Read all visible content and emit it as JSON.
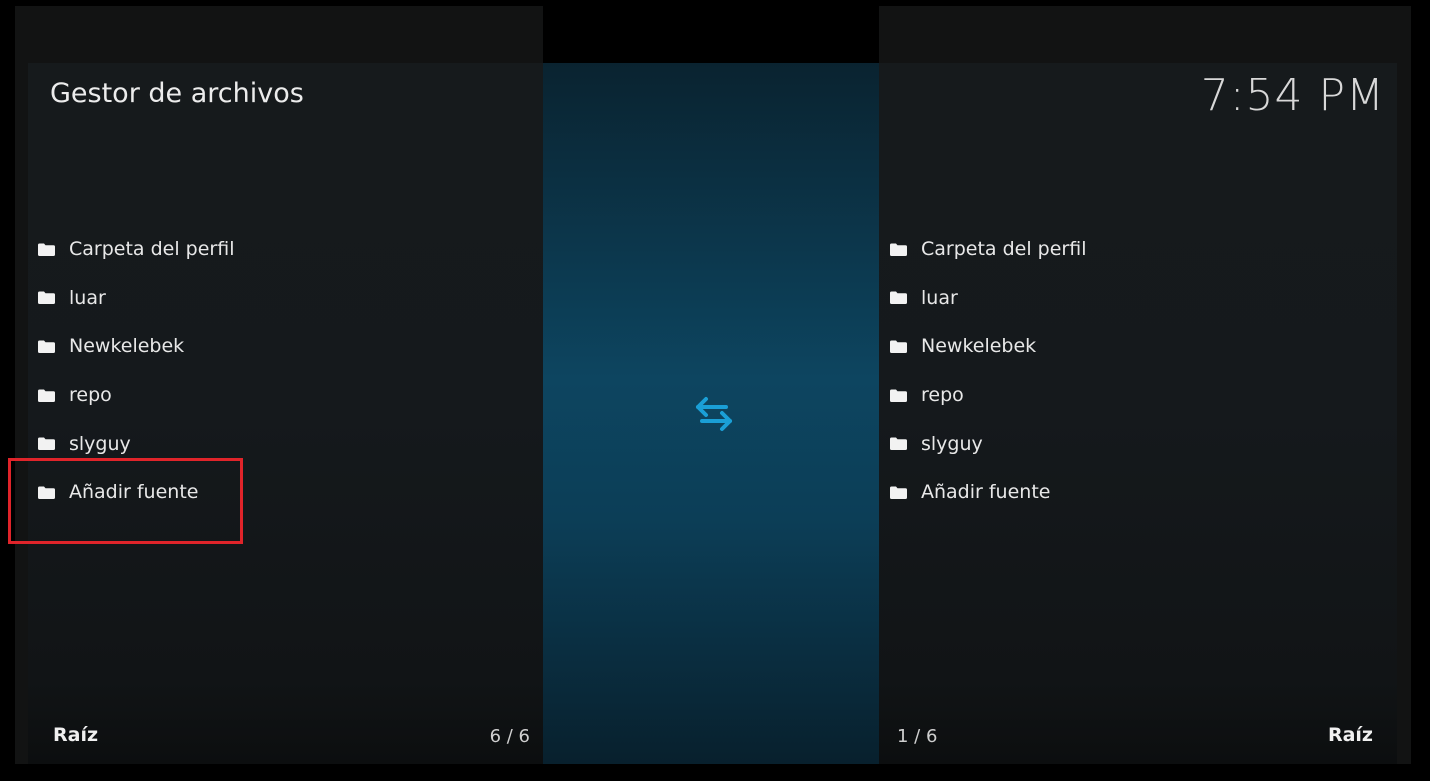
{
  "header": {
    "title": "Gestor de archivos",
    "clock": "7:54 PM"
  },
  "left_pane": {
    "items": [
      {
        "label": "Carpeta del perfil",
        "icon": "folder-icon"
      },
      {
        "label": "luar",
        "icon": "folder-icon"
      },
      {
        "label": "Newkelebek",
        "icon": "folder-icon"
      },
      {
        "label": "repo",
        "icon": "folder-icon"
      },
      {
        "label": "slyguy",
        "icon": "folder-icon"
      },
      {
        "label": "Añadir fuente",
        "icon": "folder-icon"
      }
    ],
    "location": "Raíz",
    "counter": "6 / 6"
  },
  "right_pane": {
    "items": [
      {
        "label": "Carpeta del perfil",
        "icon": "folder-icon"
      },
      {
        "label": "luar",
        "icon": "folder-icon"
      },
      {
        "label": "Newkelebek",
        "icon": "folder-icon"
      },
      {
        "label": "repo",
        "icon": "folder-icon"
      },
      {
        "label": "slyguy",
        "icon": "folder-icon"
      },
      {
        "label": "Añadir fuente",
        "icon": "folder-icon"
      }
    ],
    "location": "Raíz",
    "counter": "1 / 6"
  },
  "center": {
    "icon": "swap-arrows-icon"
  },
  "colors": {
    "accent": "#1a9fd6",
    "highlight_box": "#e0242a",
    "text": "#e8e8e8"
  }
}
